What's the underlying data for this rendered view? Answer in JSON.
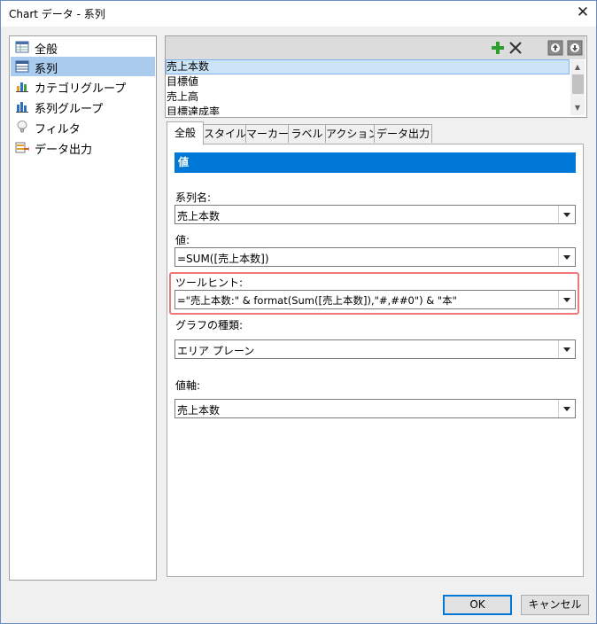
{
  "window": {
    "title": "Chart データ - 系列",
    "close_glyph": "✕"
  },
  "tree": {
    "items": [
      {
        "label": "全般",
        "icon": "grid-icon"
      },
      {
        "label": "系列",
        "icon": "table-icon",
        "selected": true
      },
      {
        "label": "カテゴリグループ",
        "icon": "bar-chart-icon"
      },
      {
        "label": "系列グループ",
        "icon": "bar-chart-icon"
      },
      {
        "label": "フィルタ",
        "icon": "filter-icon"
      },
      {
        "label": "データ出力",
        "icon": "export-icon"
      }
    ]
  },
  "series_list": {
    "items": [
      "売上本数",
      "目標値",
      "売上高",
      "目標達成率"
    ],
    "selected_index": 0
  },
  "tabs": [
    "全般",
    "スタイル",
    "マーカー",
    "ラベル",
    "アクション",
    "データ出力"
  ],
  "active_tab": "全般",
  "section": {
    "header": "値"
  },
  "fields": {
    "series_name": {
      "label": "系列名:",
      "value": "売上本数"
    },
    "value": {
      "label": "値:",
      "value": "=SUM([売上本数])"
    },
    "tooltip": {
      "label": "ツールヒント:",
      "value": "=\"売上本数:\" & format(Sum([売上本数]),\"#,##0\") & \"本\""
    },
    "chart_type": {
      "label": "グラフの種類:",
      "value": "エリア プレーン"
    },
    "value_axis": {
      "label": "値軸:",
      "value": "売上本数"
    }
  },
  "buttons": {
    "ok": "OK",
    "cancel": "キャンセル"
  },
  "colors": {
    "accent": "#0078d7",
    "selection": "#a9cbed",
    "highlight": "#f07878",
    "add": "#2ca02c"
  }
}
